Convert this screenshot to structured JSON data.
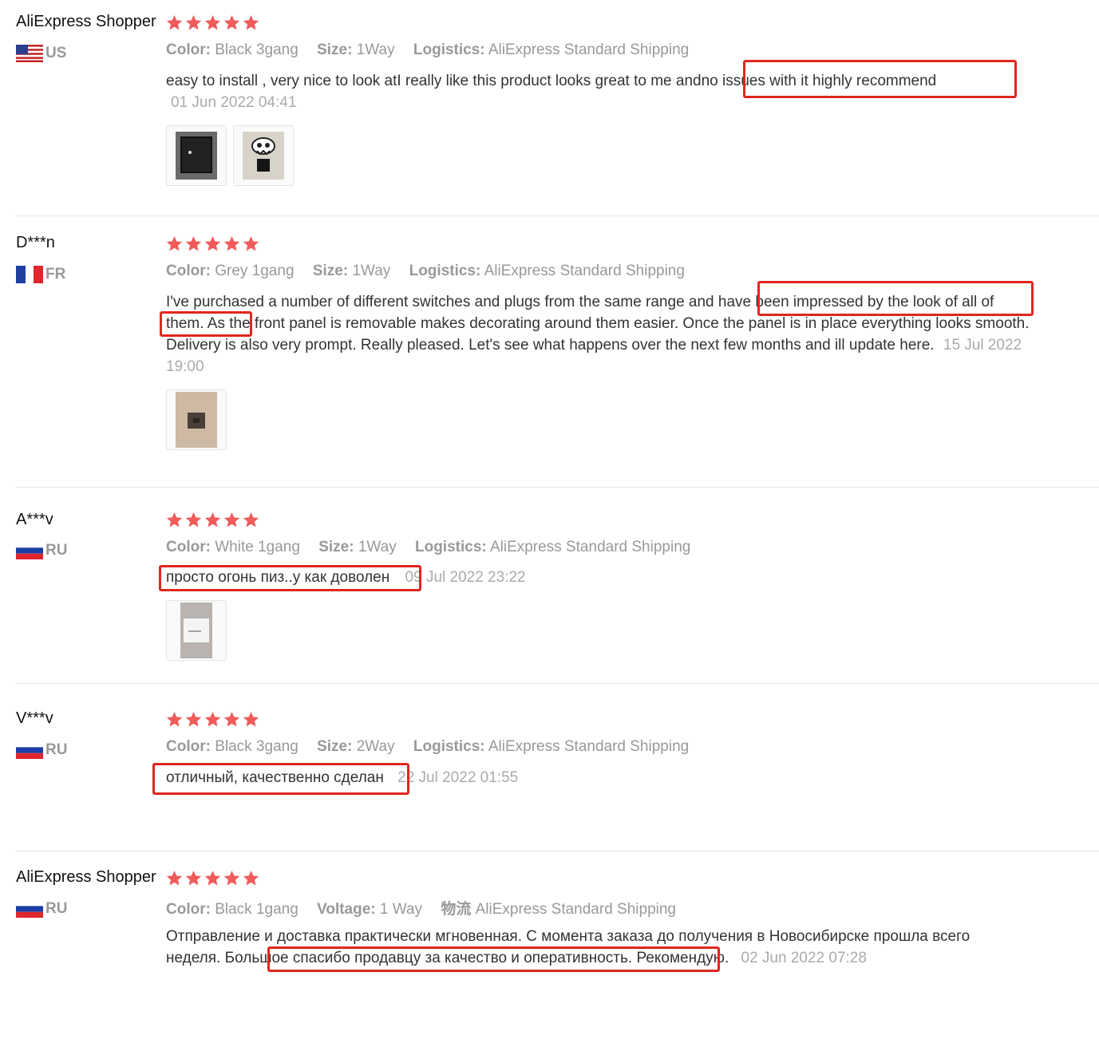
{
  "labels": {
    "color": "Color:",
    "size": "Size:",
    "logistics": "Logistics:",
    "voltage": "Voltage:",
    "logistics_cn": "物流"
  },
  "rating_max": 5,
  "star_color": "#f05b5b",
  "highlight_color": "#e0261e",
  "reviews": [
    {
      "user": "AliExpress Shopper",
      "country": "US",
      "flag": "us-flag",
      "rating": 5,
      "color": "Black 3gang",
      "size": "1Way",
      "logistics": "AliExpress Standard Shipping",
      "text_plain": "easy to install , very nice to look atI really like this product looks great to me and",
      "text_highlight": "no issues with it highly recommend",
      "date": "01 Jun 2022 04:41",
      "images": [
        "black-switch-photo",
        "decorated-switch-photo"
      ]
    },
    {
      "user": "D***n",
      "country": "FR",
      "flag": "fr-flag",
      "rating": 5,
      "color": "Grey 1gang",
      "size": "1Way",
      "logistics": "AliExpress Standard Shipping",
      "text_plain": "I've purchased a number of different switches and plugs from the same range and",
      "text_highlight": "have been impressed by the look of all of them.",
      "text_after": "As the front panel is removable makes decorating around them easier. Once the panel is in place everything looks smooth. Delivery is also very prompt. Really pleased. Let's see what happens over the next few months and ill update here.",
      "date": "15 Jul 2022 19:00",
      "images": [
        "grey-switch-photo"
      ]
    },
    {
      "user": "A***v",
      "country": "RU",
      "flag": "ru-flag",
      "rating": 5,
      "color": "White 1gang",
      "size": "1Way",
      "logistics": "AliExpress Standard Shipping",
      "text_highlight": "просто огонь пиз..у как доволен",
      "date": "09 Jul 2022 23:22",
      "images": [
        "white-switch-photo"
      ]
    },
    {
      "user": "V***v",
      "country": "RU",
      "flag": "ru-flag",
      "rating": 5,
      "color": "Black 3gang",
      "size": "2Way",
      "logistics": "AliExpress Standard Shipping",
      "text_highlight": "отличный, качественно сделан",
      "date": "22 Jul 2022 01:55"
    },
    {
      "user": "AliExpress Shopper",
      "country": "RU",
      "flag": "ru-flag",
      "rating": 5,
      "color": "Black 1gang",
      "voltage": "1 Way",
      "logistics": "AliExpress Standard Shipping",
      "text_plain": "Отправление и доставка практически мгновенная. С момента заказа до получения в Новосибирске прошла всего неделя.",
      "text_highlight": "Большое спасибо продавцу за качество и оперативность.",
      "text_after": "Рекомендую.",
      "date": "02 Jun 2022 07:28"
    }
  ]
}
